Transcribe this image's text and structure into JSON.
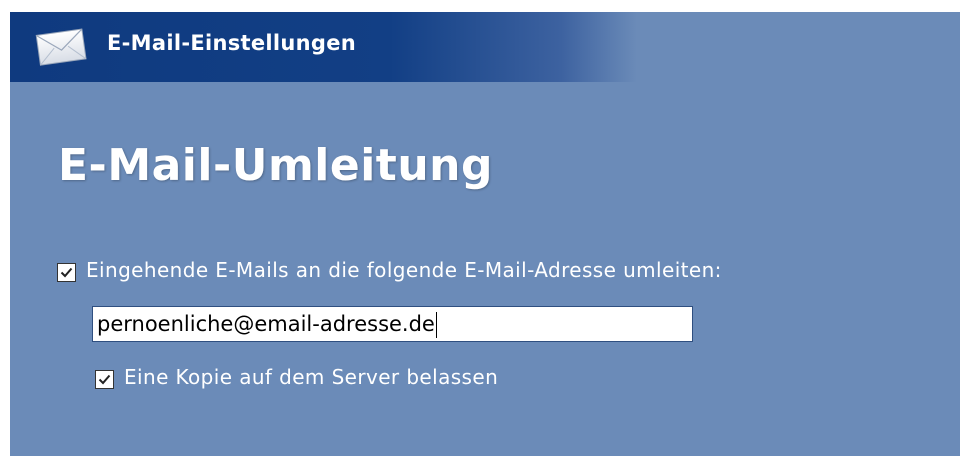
{
  "header": {
    "title": "E-Mail-Einstellungen",
    "icon": "envelope-icon"
  },
  "main": {
    "title": "E-Mail-Umleitung",
    "redirect": {
      "checked": true,
      "label": "Eingehende E-Mails an die folgende E-Mail-Adresse umleiten:"
    },
    "email": {
      "value": "pernoenliche@email-adresse.de"
    },
    "keep_copy": {
      "checked": true,
      "label": "Eine Kopie auf dem Server belassen"
    }
  },
  "colors": {
    "header_dark": "#0f3a7f",
    "panel_bg": "#6b8bb8",
    "text": "#ffffff"
  }
}
